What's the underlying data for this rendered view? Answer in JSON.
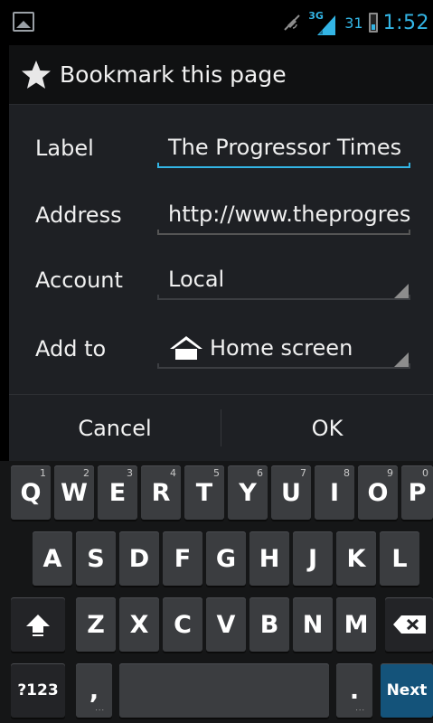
{
  "status_bar": {
    "network": "3G",
    "battery_level": "31",
    "time": "1:52"
  },
  "dialog": {
    "title": "Bookmark this page",
    "icon": "star-icon",
    "fields": {
      "label": {
        "label": "Label",
        "value": "The Progressor Times"
      },
      "address": {
        "label": "Address",
        "value": "http://www.theprogressor"
      },
      "account": {
        "label": "Account",
        "value": "Local"
      },
      "add_to": {
        "label": "Add to",
        "value": "Home screen",
        "icon": "home-icon"
      }
    },
    "buttons": {
      "cancel": "Cancel",
      "ok": "OK"
    }
  },
  "keyboard": {
    "row1": [
      {
        "key": "Q",
        "hint": "1"
      },
      {
        "key": "W",
        "hint": "2"
      },
      {
        "key": "E",
        "hint": "3"
      },
      {
        "key": "R",
        "hint": "4"
      },
      {
        "key": "T",
        "hint": "5"
      },
      {
        "key": "Y",
        "hint": "6"
      },
      {
        "key": "U",
        "hint": "7"
      },
      {
        "key": "I",
        "hint": "8"
      },
      {
        "key": "O",
        "hint": "9"
      },
      {
        "key": "P",
        "hint": "0"
      }
    ],
    "row2": [
      "A",
      "S",
      "D",
      "F",
      "G",
      "H",
      "J",
      "K",
      "L"
    ],
    "row3": [
      "Z",
      "X",
      "C",
      "V",
      "B",
      "N",
      "M"
    ],
    "symbols_label": "?123",
    "comma_label": ",",
    "period_label": ".",
    "next_label": "Next",
    "colors": {
      "accent": "#33b5e5",
      "next_key": "#14537a"
    }
  }
}
